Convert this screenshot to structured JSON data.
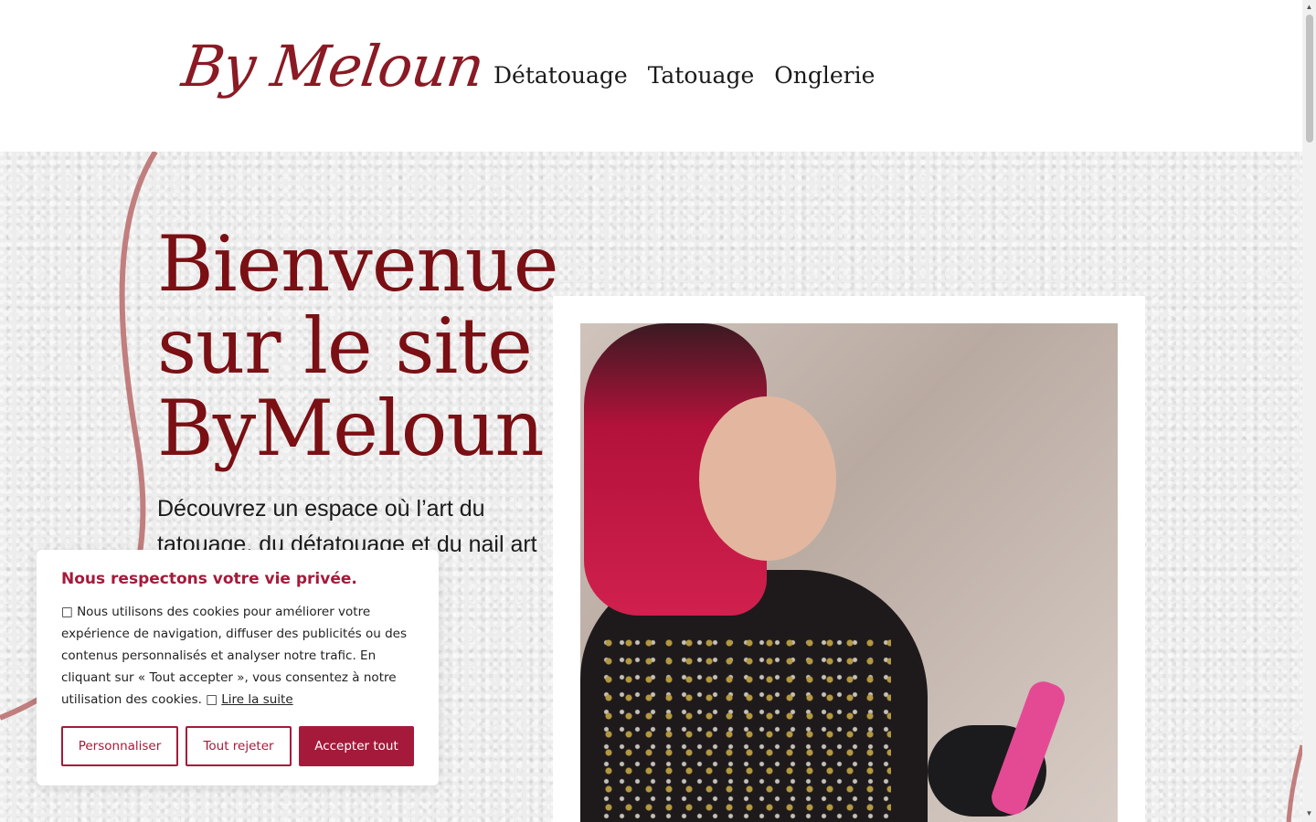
{
  "header": {
    "logo_text": "By Meloun",
    "nav": [
      "Détatouage",
      "Tatouage",
      "Onglerie"
    ]
  },
  "hero": {
    "title": "Bienvenue sur le site ByMeloun",
    "text": "Découvrez un espace où l’art du tatouage, du détatouage et du nail art … approche"
  },
  "cookie": {
    "title": "Nous respectons votre vie privée.",
    "icon_before": "□",
    "text": "Nous utilisons des cookies pour améliorer votre expérience de navigation, diffuser des publicités ou des contenus personnalisés et analyser notre trafic. En cliquant sur « Tout accepter », vous consentez à notre utilisation des cookies.",
    "icon_link": "□",
    "link": "Lire la suite",
    "buttons": {
      "customize": "Personnaliser",
      "reject": "Tout rejeter",
      "accept": "Accepter tout"
    }
  },
  "colors": {
    "brand": "#7a0f14",
    "cookie_accent": "#a51a3a"
  }
}
